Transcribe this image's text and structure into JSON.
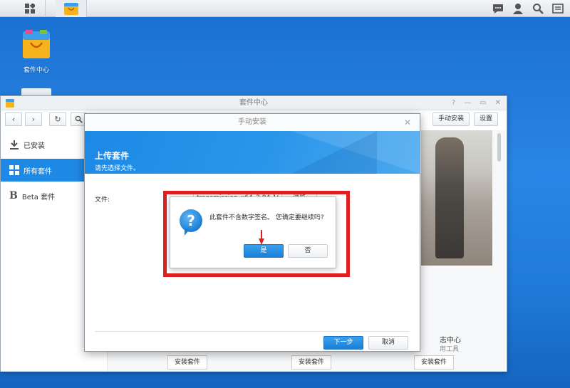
{
  "taskbar": {
    "icons": [
      "main-menu-icon",
      "package-center-icon",
      "chat-icon",
      "user-icon",
      "search-icon",
      "widgets-icon"
    ]
  },
  "desktop": {
    "icon_label": "套件中心"
  },
  "package_center": {
    "title": "套件中心",
    "toolbar": {
      "manual_install_label": "手动安装",
      "settings_label": "设置"
    },
    "sidebar": {
      "items": [
        {
          "label": "已安装",
          "icon": "download-icon"
        },
        {
          "label": "所有套件",
          "icon": "grid-icon"
        },
        {
          "label": "Beta 套件",
          "icon": "beta-icon"
        }
      ],
      "active_index": 1
    },
    "cards": {
      "install_label": "安装套件",
      "partial_title": "志中心",
      "partial_subtitle": "用工具"
    }
  },
  "install_dialog": {
    "title": "手动安装",
    "header_title": "上传套件",
    "header_subtitle": "请先选择文件。",
    "file_label": "文件:",
    "file_value": "transmission_x64_2.94-16.spk",
    "browse_label": "浏览",
    "next_label": "下一步",
    "cancel_label": "取消"
  },
  "confirm": {
    "message": "此套件不含数字签名。 您确定要继续吗?",
    "yes_label": "是",
    "no_label": "否"
  },
  "colors": {
    "accent": "#1e88e5",
    "highlight": "#e02020"
  }
}
